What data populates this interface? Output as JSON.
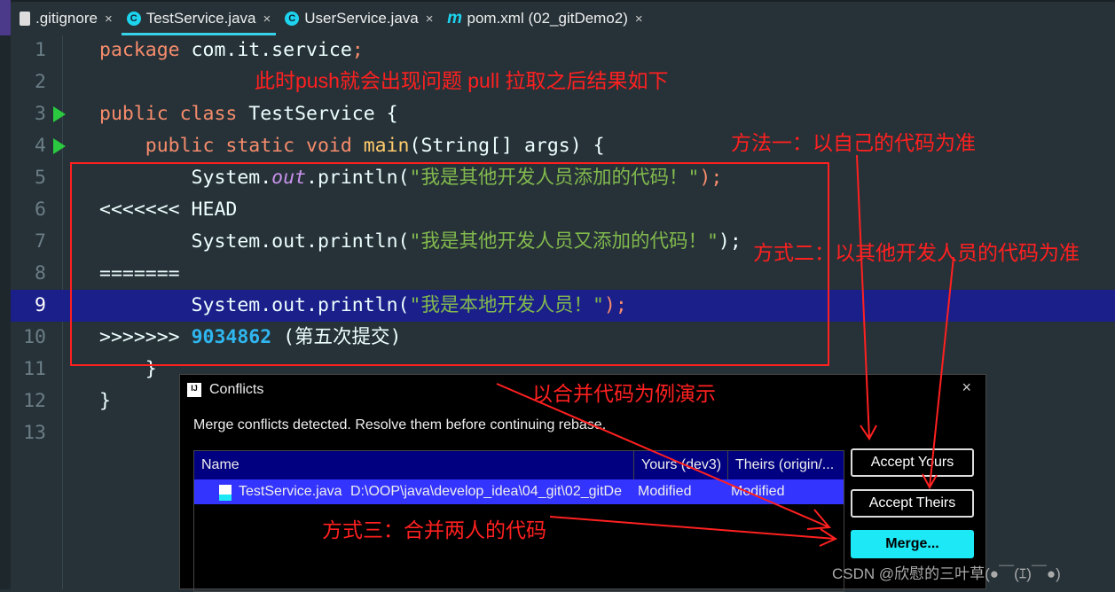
{
  "tabs": [
    {
      "label": ".gitignore",
      "icon": "file-ignore-icon"
    },
    {
      "label": "TestService.java",
      "icon": "java-class-icon",
      "active": true
    },
    {
      "label": "UserService.java",
      "icon": "java-class-icon"
    },
    {
      "label": "pom.xml (02_gitDemo2)",
      "icon": "maven-icon"
    }
  ],
  "code": {
    "l1": [
      "package",
      " com.it.service",
      ";"
    ],
    "l3": [
      "public class",
      " TestService {"
    ],
    "l4": [
      "    public static void ",
      "main",
      "(String[] args) {"
    ],
    "l5": [
      "        System.",
      "out",
      ".println(",
      "\"我是其他开发人员添加的代码！\"",
      ");"
    ],
    "l6": "<<<<<<< HEAD",
    "l7": [
      "        System.out.println(",
      "\"我是其他开发人员又添加的代码！\"",
      ");"
    ],
    "l8": "=======",
    "l9": [
      "        System.out.println(",
      "\"我是本地开发人员！\"",
      ");"
    ],
    "l10": [
      ">>>>>>> ",
      "9034862",
      " (第五次提交)"
    ],
    "l11": "    }",
    "l12": "}",
    "numbers": [
      "1",
      "2",
      "3",
      "4",
      "5",
      "6",
      "7",
      "8",
      "9",
      "10",
      "11",
      "12",
      "13"
    ]
  },
  "annotations": {
    "a1": "此时push就会出现问题 pull 拉取之后结果如下",
    "a2": "方法一：以自己的代码为准",
    "a3": "方式二：以其他开发人员的代码为准",
    "a4": "以合并代码为例演示",
    "a5": "方式三：合并两人的代码"
  },
  "dialog": {
    "title": "Conflicts",
    "close": "×",
    "message": "Merge conflicts detected. Resolve them before continuing rebase.",
    "columns": [
      "Name",
      "Yours (dev3)",
      "Theirs (origin/..."
    ],
    "rows": [
      {
        "name": "TestService.java",
        "path": "D:\\OOP\\java\\develop_idea\\04_git\\02_gitDe",
        "yours": "Modified",
        "theirs": "Modified"
      }
    ],
    "buttons": {
      "accept_yours": "Accept Yours",
      "accept_theirs": "Accept Theirs",
      "merge": "Merge..."
    }
  },
  "watermark": "CSDN @欣慰的三叶草(●￣(ｴ)￣●)"
}
